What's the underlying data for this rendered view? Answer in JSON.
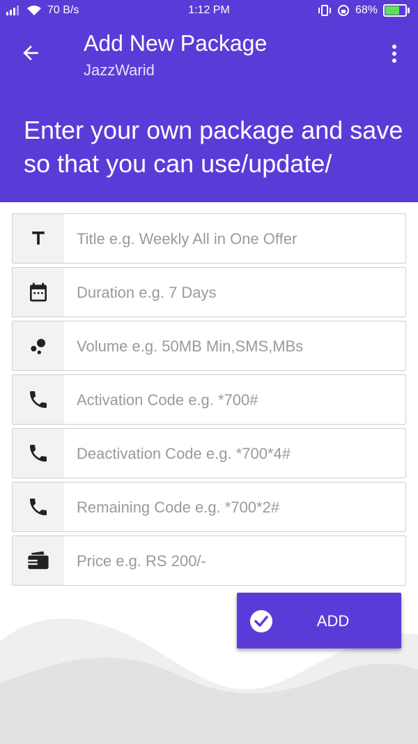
{
  "status_bar": {
    "network_speed": "70 B/s",
    "time": "1:12 PM",
    "battery": "68%",
    "battery_fraction": 0.68
  },
  "app_bar": {
    "title": "Add New Package",
    "subtitle": "JazzWarid",
    "back_icon": "arrow-back-icon",
    "more_icon": "more-vert-icon"
  },
  "banner": {
    "text": "Enter your own package and save so that you can use/update/"
  },
  "form": {
    "fields": [
      {
        "icon": "title-icon",
        "placeholder": "Title e.g. Weekly All in One Offer",
        "value": ""
      },
      {
        "icon": "calendar-icon",
        "placeholder": "Duration e.g. 7 Days",
        "value": ""
      },
      {
        "icon": "bubbles-icon",
        "placeholder": "Volume e.g. 50MB Min,SMS,MBs",
        "value": ""
      },
      {
        "icon": "phone-icon",
        "placeholder": "Activation Code e.g. *700#",
        "value": ""
      },
      {
        "icon": "phone-icon",
        "placeholder": "Deactivation Code e.g. *700*4#",
        "value": ""
      },
      {
        "icon": "phone-icon",
        "placeholder": "Remaining Code e.g. *700*2#",
        "value": ""
      },
      {
        "icon": "wallet-icon",
        "placeholder": "Price e.g. RS 200/-",
        "value": ""
      }
    ]
  },
  "add_button": {
    "label": "ADD",
    "icon": "check-circle-icon"
  },
  "colors": {
    "primary": "#5b3bd8",
    "icon_bg": "#f4f2f1",
    "wave_light": "#efefef",
    "wave_dark": "#e2e2e2"
  }
}
